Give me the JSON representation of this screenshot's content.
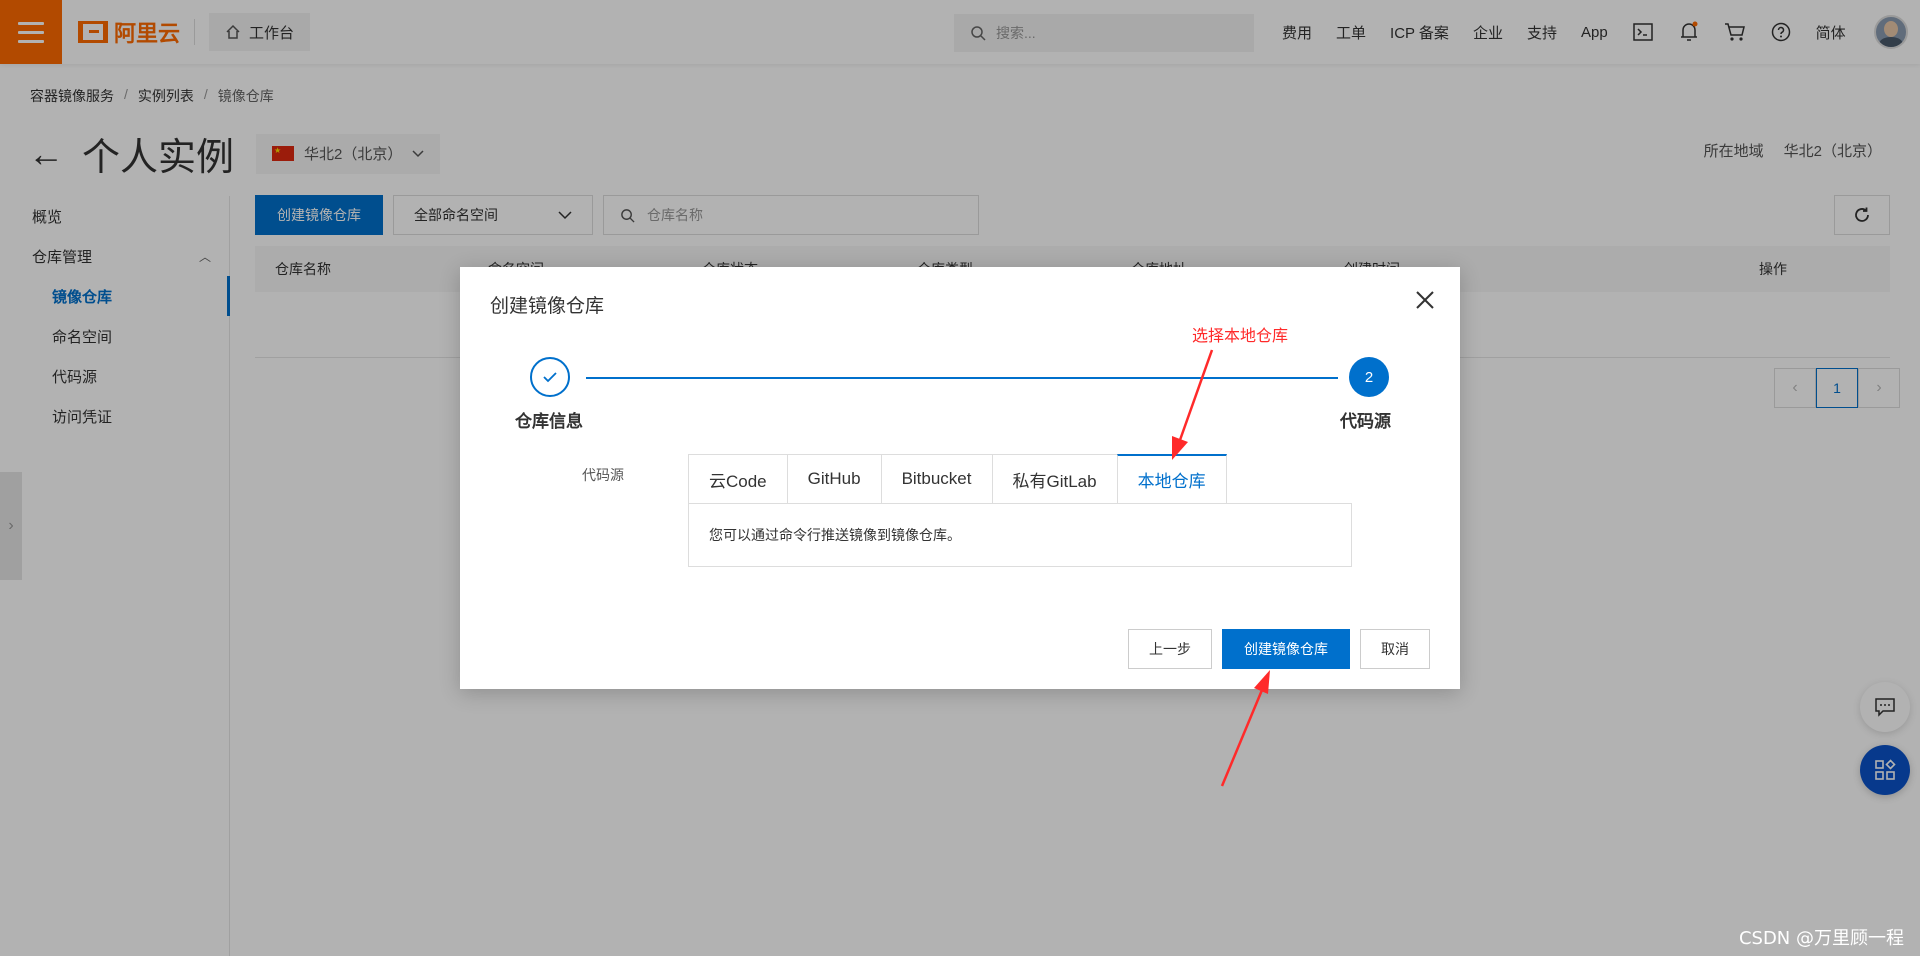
{
  "topbar": {
    "logo_text": "阿里云",
    "workbench_label": "工作台",
    "search_placeholder": "搜索...",
    "nav_links": [
      "费用",
      "工单",
      "ICP 备案",
      "企业",
      "支持",
      "App"
    ],
    "lang_label": "简体"
  },
  "breadcrumb": [
    "容器镜像服务",
    "实例列表",
    "镜像仓库"
  ],
  "page": {
    "title": "个人实例",
    "region_select": "华北2（北京）",
    "region_right_label": "所在地域",
    "region_right_value": "华北2（北京）"
  },
  "sidebar": {
    "overview": "概览",
    "repo_mgmt": "仓库管理",
    "items": [
      "镜像仓库",
      "命名空间",
      "代码源",
      "访问凭证"
    ]
  },
  "toolbar": {
    "create_label": "创建镜像仓库",
    "namespace_select": "全部命名空间",
    "repo_placeholder": "仓库名称"
  },
  "table": {
    "columns": [
      "仓库名称",
      "命名空间",
      "仓库状态",
      "仓库类型",
      "仓库地址",
      "创建时间",
      "操作"
    ]
  },
  "pager": {
    "current": "1"
  },
  "dialog": {
    "title": "创建镜像仓库",
    "step1_label": "仓库信息",
    "step2_number": "2",
    "step2_label": "代码源",
    "field_label": "代码源",
    "tabs": [
      "云Code",
      "GitHub",
      "Bitbucket",
      "私有GitLab",
      "本地仓库"
    ],
    "active_tab": "本地仓库",
    "panel_text": "您可以通过命令行推送镜像到镜像仓库。",
    "btn_prev": "上一步",
    "btn_create": "创建镜像仓库",
    "btn_cancel": "取消"
  },
  "annotation": {
    "text": "选择本地仓库"
  },
  "watermark": "CSDN @万里顾一程",
  "colors": {
    "brand_orange": "#ff6a00",
    "primary_blue": "#0070cc",
    "annotation_red": "#ff2a2a"
  }
}
